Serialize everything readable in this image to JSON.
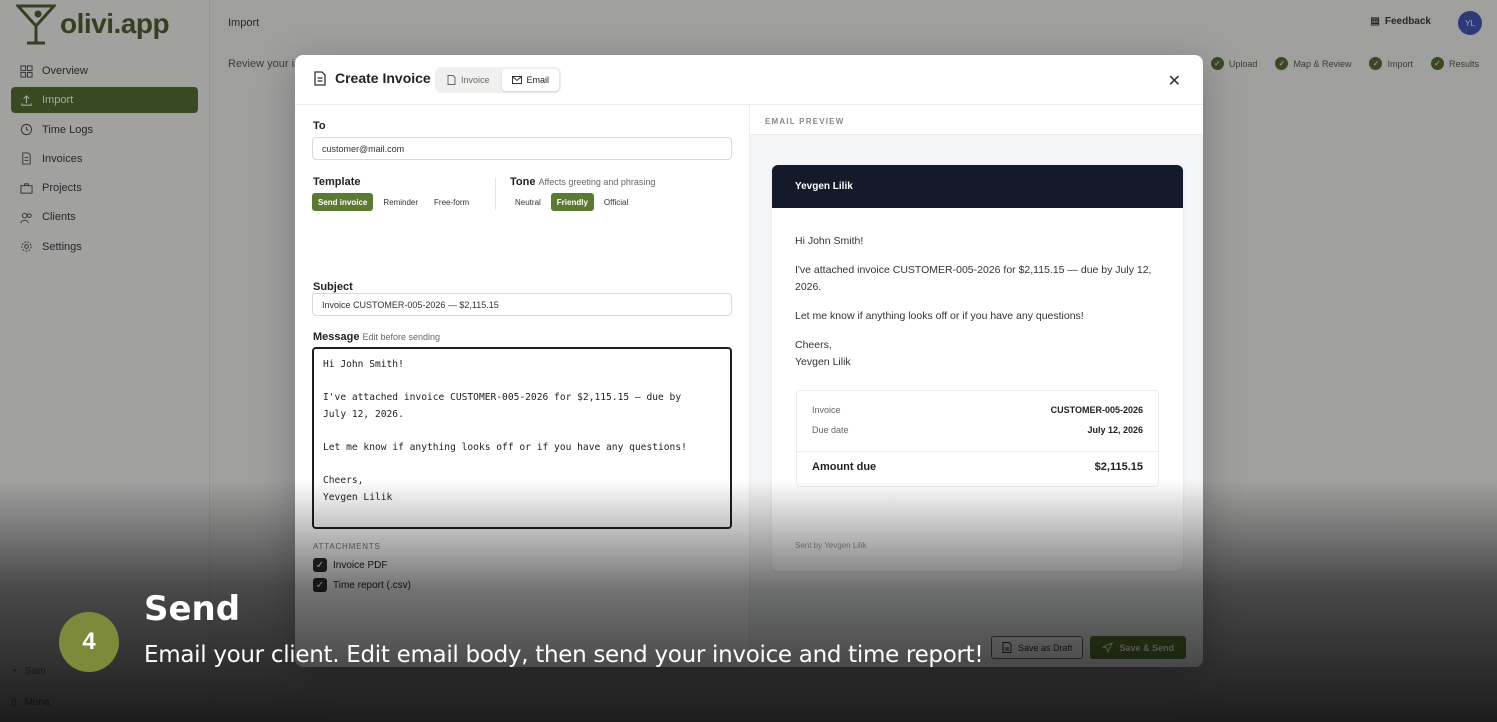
{
  "app": {
    "logo": "olivi.app",
    "breadcrumb": "Import",
    "subtitle": "Review your in",
    "feedback": "Feedback",
    "avatar": "YL",
    "nav": [
      {
        "label": "Overview",
        "icon": "grid-icon"
      },
      {
        "label": "Import",
        "icon": "upload-icon",
        "active": true
      },
      {
        "label": "Time Logs",
        "icon": "clock-icon"
      },
      {
        "label": "Invoices",
        "icon": "file-icon"
      },
      {
        "label": "Projects",
        "icon": "briefcase-icon"
      },
      {
        "label": "Clients",
        "icon": "users-icon"
      },
      {
        "label": "Settings",
        "icon": "gear-icon"
      }
    ],
    "steps": [
      "Upload",
      "Map & Review",
      "Import",
      "Results"
    ],
    "sidebar_bottom": [
      "Sam",
      "Mona"
    ]
  },
  "modal": {
    "title": "Create Invoice",
    "tabs": [
      {
        "label": "Invoice",
        "active": false
      },
      {
        "label": "Email",
        "active": true
      }
    ],
    "to_label": "To",
    "to_value": "customer@mail.com",
    "template_label": "Template",
    "templates": [
      {
        "label": "Send invoice",
        "on": true
      },
      {
        "label": "Reminder",
        "on": false
      },
      {
        "label": "Free-form",
        "on": false
      }
    ],
    "tone_label": "Tone",
    "tone_hint": "Affects greeting and phrasing",
    "tones": [
      {
        "label": "Neutral",
        "on": false
      },
      {
        "label": "Friendly",
        "on": true
      },
      {
        "label": "Official",
        "on": false
      }
    ],
    "subject_label": "Subject",
    "subject_value": "Invoice CUSTOMER-005-2026 — $2,115.15",
    "message_label": "Message",
    "message_hint": "Edit before sending",
    "message_lines": [
      "Hi John Smith!",
      "",
      "I've attached invoice CUSTOMER-005-2026 for $2,115.15 — due by",
      "July 12, 2026.",
      "",
      "Let me know if anything looks off or if you have any questions!",
      "",
      "Cheers,",
      "Yevgen Lilik"
    ],
    "attachments_label": "ATTACHMENTS",
    "attachments": [
      "Invoice PDF",
      "Time report (.csv)"
    ],
    "save_draft": "Save as Draft",
    "save_send": "Save & Send"
  },
  "preview": {
    "heading": "EMAIL PREVIEW",
    "sender": "Yevgen Lilik",
    "greeting": "Hi John Smith!",
    "para1": "I've attached invoice CUSTOMER-005-2026 for $2,115.15 — due by July 12, 2026.",
    "para2": "Let me know if anything looks off or if you have any questions!",
    "signoff": "Cheers,",
    "signature": "Yevgen Lilik",
    "invoice_label": "Invoice",
    "invoice_value": "CUSTOMER-005-2026",
    "due_label": "Due date",
    "due_value": "July 12, 2026",
    "amount_label": "Amount due",
    "amount_value": "$2,115.15",
    "sent_by": "Sent by Yevgen Lilik"
  },
  "caption": {
    "step": "4",
    "title": "Send",
    "text": "Email your client. Edit email body, then send your invoice and time report!"
  },
  "colors": {
    "accent": "#5b7a32",
    "email_header": "#141a29",
    "badge": "#7d8a3c"
  }
}
